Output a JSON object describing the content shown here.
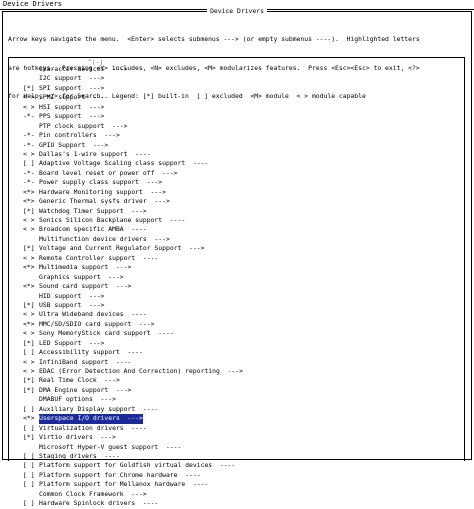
{
  "window": {
    "title": "Device Drivers"
  },
  "dialog": {
    "title": "Device Drivers",
    "help_lines": [
      "Arrow keys navigate the menu.  <Enter> selects submenus ---> (or empty submenus ----).  Highlighted letters",
      "are hotkeys.  Pressing <Y> includes, <N> excludes, <M> modularizes features.  Press <Esc><Esc> to exit, <?>",
      "for Help, </> for Search.  Legend: [*] built-in  [ ] excluded  <M> module  < > module capable"
    ],
    "scroll_indicator": "^(-)"
  },
  "menu": {
    "items": [
      {
        "mark": "",
        "label": "Character devices  --->"
      },
      {
        "mark": "",
        "label": "I2C support  --->"
      },
      {
        "mark": "[*]",
        "label": "SPI support  --->"
      },
      {
        "mark": "< >",
        "label": "SPMI support  ----"
      },
      {
        "mark": "< >",
        "label": "HSI support  --->"
      },
      {
        "mark": "-*-",
        "label": "PPS support  --->"
      },
      {
        "mark": "",
        "label": "PTP clock support  --->"
      },
      {
        "mark": "-*-",
        "label": "Pin controllers  --->"
      },
      {
        "mark": "-*-",
        "label": "GPIO Support  --->"
      },
      {
        "mark": "< >",
        "label": "Dallas's 1-wire support  ----"
      },
      {
        "mark": "[ ]",
        "label": "Adaptive Voltage Scaling class support  ----"
      },
      {
        "mark": "-*-",
        "label": "Board level reset or power off  --->"
      },
      {
        "mark": "-*-",
        "label": "Power supply class support  --->"
      },
      {
        "mark": "<*>",
        "label": "Hardware Monitoring support  --->"
      },
      {
        "mark": "<*>",
        "label": "Generic Thermal sysfs driver  --->"
      },
      {
        "mark": "[*]",
        "label": "Watchdog Timer Support  --->"
      },
      {
        "mark": "< >",
        "label": "Sonics Silicon Backplane support  ----"
      },
      {
        "mark": "< >",
        "label": "Broadcom specific AMBA  ----"
      },
      {
        "mark": "",
        "label": "Multifunction device drivers  --->"
      },
      {
        "mark": "[*]",
        "label": "Voltage and Current Regulator Support  --->"
      },
      {
        "mark": "< >",
        "label": "Remote Controller support  ----"
      },
      {
        "mark": "<*>",
        "label": "Multimedia support  --->"
      },
      {
        "mark": "",
        "label": "Graphics support  --->"
      },
      {
        "mark": "<*>",
        "label": "Sound card support  --->"
      },
      {
        "mark": "",
        "label": "HID support  --->"
      },
      {
        "mark": "[*]",
        "label": "USB support  --->"
      },
      {
        "mark": "< >",
        "label": "Ultra Wideband devices  ----"
      },
      {
        "mark": "<*>",
        "label": "MMC/SD/SDIO card support  --->"
      },
      {
        "mark": "< >",
        "label": "Sony MemoryStick card support  ----"
      },
      {
        "mark": "[*]",
        "label": "LED Support  --->"
      },
      {
        "mark": "[ ]",
        "label": "Accessibility support  ----"
      },
      {
        "mark": "< >",
        "label": "InfiniBand support  ----"
      },
      {
        "mark": "< >",
        "label": "EDAC (Error Detection And Correction) reporting  --->"
      },
      {
        "mark": "[*]",
        "label": "Real Time Clock  --->"
      },
      {
        "mark": "[*]",
        "label": "DMA Engine support  --->"
      },
      {
        "mark": "",
        "label": "DMABUF options  --->"
      },
      {
        "mark": "[ ]",
        "label": "Auxiliary Display support  ----"
      },
      {
        "mark": "<*>",
        "label": "Userspace I/O drivers  --->",
        "selected": true
      },
      {
        "mark": "[ ]",
        "label": "Virtualization drivers  ----"
      },
      {
        "mark": "[*]",
        "label": "Virtio drivers  --->"
      },
      {
        "mark": "",
        "label": "Microsoft Hyper-V guest support  ----"
      },
      {
        "mark": "[ ]",
        "label": "Staging drivers  ----"
      },
      {
        "mark": "[ ]",
        "label": "Platform support for Goldfish virtual devices  ----"
      },
      {
        "mark": "[ ]",
        "label": "Platform support for Chrome hardware  ----"
      },
      {
        "mark": "[ ]",
        "label": "Platform support for Mellanox hardware  ----"
      },
      {
        "mark": "",
        "label": "Common Clock Framework  --->"
      },
      {
        "mark": "[ ]",
        "label": "Hardware Spinlock drivers  ----"
      }
    ]
  }
}
